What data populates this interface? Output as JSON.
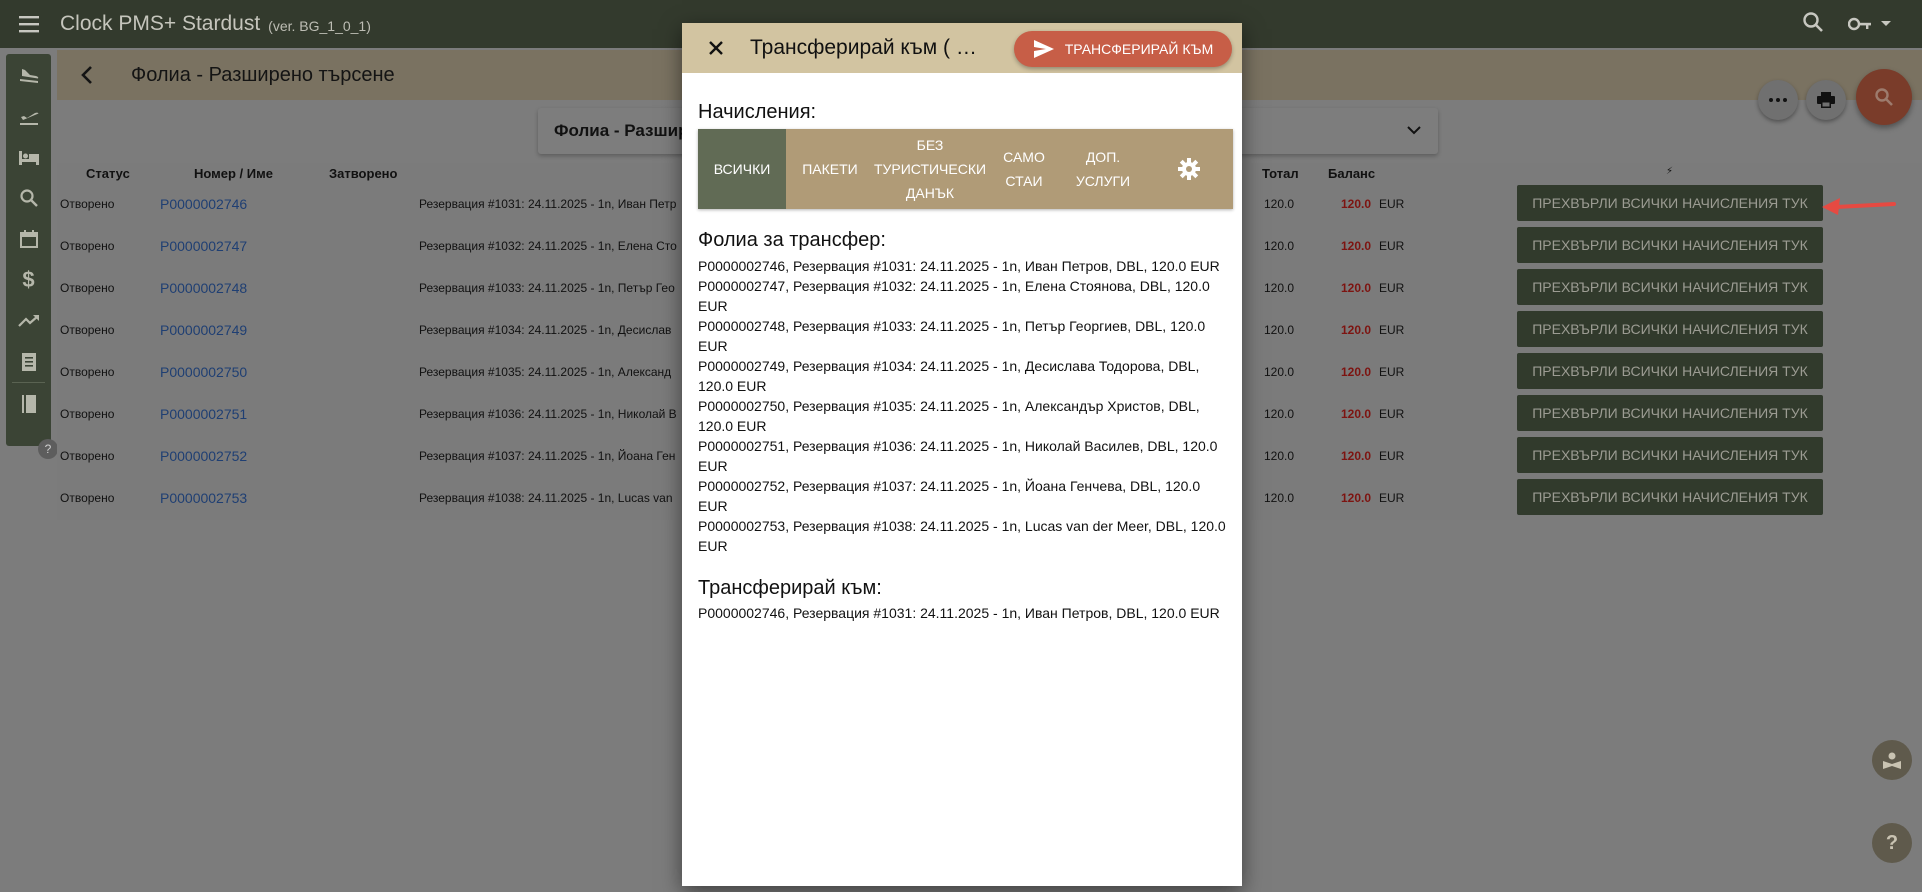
{
  "app": {
    "title": "Clock PMS+  Stardust",
    "version": "(ver. BG_1_0_1)"
  },
  "page": {
    "title": "Фолиа - Разширено търсене",
    "filter_title": "Фолиа - Разшир"
  },
  "table": {
    "headers": {
      "status": "Статус",
      "number": "Номер / Име",
      "closed": "Затворено",
      "total": "Тотал",
      "balance": "Баланс",
      "action": "⚡"
    },
    "rows": [
      {
        "status": "Отворено",
        "number": "P0000002746",
        "desc": "Резервация #1031: 24.11.2025 - 1n, Иван Петр",
        "total": "120.0",
        "balance": "120.0",
        "currency": "EUR",
        "action": "ПРЕХВЪРЛИ ВСИЧКИ НАЧИСЛЕНИЯ ТУК"
      },
      {
        "status": "Отворено",
        "number": "P0000002747",
        "desc": "Резервация #1032: 24.11.2025 - 1n, Елена Сто",
        "total": "120.0",
        "balance": "120.0",
        "currency": "EUR",
        "action": "ПРЕХВЪРЛИ ВСИЧКИ НАЧИСЛЕНИЯ ТУК"
      },
      {
        "status": "Отворено",
        "number": "P0000002748",
        "desc": "Резервация #1033: 24.11.2025 - 1n, Петър Гео",
        "total": "120.0",
        "balance": "120.0",
        "currency": "EUR",
        "action": "ПРЕХВЪРЛИ ВСИЧКИ НАЧИСЛЕНИЯ ТУК"
      },
      {
        "status": "Отворено",
        "number": "P0000002749",
        "desc": "Резервация #1034: 24.11.2025 - 1n, Десислав",
        "total": "120.0",
        "balance": "120.0",
        "currency": "EUR",
        "action": "ПРЕХВЪРЛИ ВСИЧКИ НАЧИСЛЕНИЯ ТУК"
      },
      {
        "status": "Отворено",
        "number": "P0000002750",
        "desc": "Резервация #1035: 24.11.2025 - 1n, Александ",
        "total": "120.0",
        "balance": "120.0",
        "currency": "EUR",
        "action": "ПРЕХВЪРЛИ ВСИЧКИ НАЧИСЛЕНИЯ ТУК"
      },
      {
        "status": "Отворено",
        "number": "P0000002751",
        "desc": "Резервация #1036: 24.11.2025 - 1n, Николай В",
        "total": "120.0",
        "balance": "120.0",
        "currency": "EUR",
        "action": "ПРЕХВЪРЛИ ВСИЧКИ НАЧИСЛЕНИЯ ТУК"
      },
      {
        "status": "Отворено",
        "number": "P0000002752",
        "desc": "Резервация #1037: 24.11.2025 - 1n, Йоана Ген",
        "total": "120.0",
        "balance": "120.0",
        "currency": "EUR",
        "action": "ПРЕХВЪРЛИ ВСИЧКИ НАЧИСЛЕНИЯ ТУК"
      },
      {
        "status": "Отворено",
        "number": "P0000002753",
        "desc": "Резервация #1038: 24.11.2025 - 1n, Lucas van",
        "total": "120.0",
        "balance": "120.0",
        "currency": "EUR",
        "action": "ПРЕХВЪРЛИ ВСИЧКИ НАЧИСЛЕНИЯ ТУК"
      }
    ]
  },
  "dialog": {
    "title": "Трансферирай към ( В...",
    "send_label": "ТРАНСФЕРИРАЙ КЪМ",
    "charges_title": "Начисления:",
    "tabs": [
      "ВСИЧКИ",
      "ПАКЕТИ",
      "БЕЗ ТУРИСТИЧЕСКИ ДАНЪК",
      "САМО СТАИ",
      "ДОП. УСЛУГИ"
    ],
    "folios_title": "Фолиа за трансфер:",
    "folios": [
      "P0000002746, Резервация #1031: 24.11.2025 - 1n, Иван Петров, DBL, 120.0 EUR",
      "P0000002747, Резервация #1032: 24.11.2025 - 1n, Елена Стоянова, DBL, 120.0 EUR",
      "P0000002748, Резервация #1033: 24.11.2025 - 1n, Петър Георгиев, DBL, 120.0 EUR",
      "P0000002749, Резервация #1034: 24.11.2025 - 1n, Десислава Тодорова, DBL, 120.0 EUR",
      "P0000002750, Резервация #1035: 24.11.2025 - 1n, Александър Христов, DBL, 120.0 EUR",
      "P0000002751, Резервация #1036: 24.11.2025 - 1n, Николай Василев, DBL, 120.0 EUR",
      "P0000002752, Резервация #1037: 24.11.2025 - 1n, Йоана Генчева, DBL, 120.0 EUR",
      "P0000002753, Резервация #1038: 24.11.2025 - 1n, Lucas van der Meer, DBL, 120.0 EUR"
    ],
    "target_title": "Трансферирай към:",
    "target": "P0000002746, Резервация #1031: 24.11.2025 - 1n, Иван Петров, DBL, 120.0 EUR"
  },
  "colors": {
    "topbar": "#333a2d",
    "accent": "#c75e47",
    "active_tab": "#616b55",
    "tab_bg": "#b09b77",
    "balance": "#7d1411"
  }
}
